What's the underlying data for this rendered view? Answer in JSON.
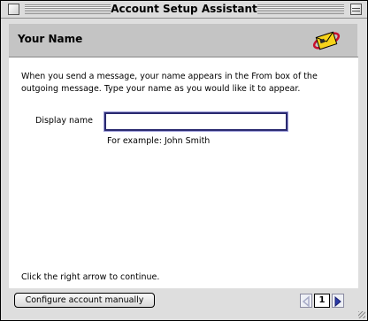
{
  "window": {
    "title": "Account Setup Assistant"
  },
  "header": {
    "page_title": "Your Name",
    "logo_icon": "mail-envelope-icon"
  },
  "content": {
    "intro_text": "When you send a message, your name appears in the From box of the outgoing message. Type your name as you would like it to appear.",
    "display_name_label": "Display name",
    "display_name_value": "",
    "example_text": "For example: John Smith",
    "hint_text": "Click the right arrow to continue."
  },
  "footer": {
    "configure_button_label": "Configure account manually",
    "page_number": "1",
    "prev_icon": "left-arrow-icon",
    "next_icon": "right-arrow-icon"
  },
  "colors": {
    "header_bg": "#c4c4c4",
    "window_bg": "#dedede",
    "input_border": "#2a2a70",
    "arrow_active": "#2a3aa8",
    "arrow_disabled": "#a8acc8"
  }
}
